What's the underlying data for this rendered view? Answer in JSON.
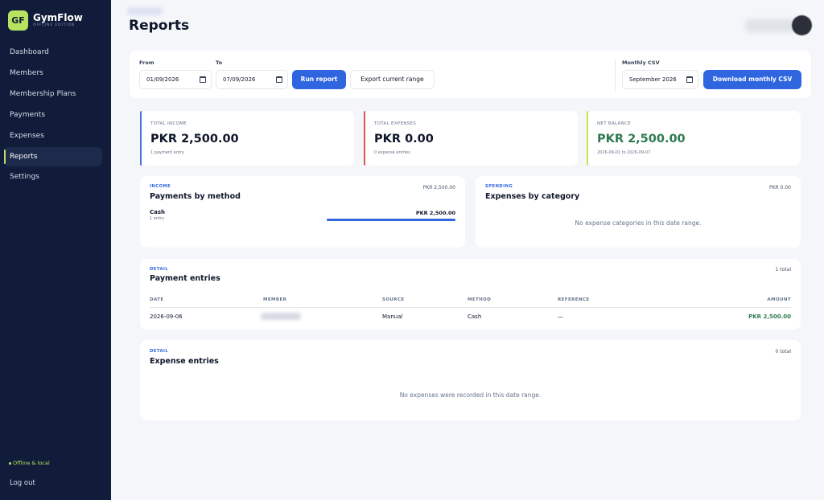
{
  "app": {
    "logo": "GF",
    "name": "GymFlow",
    "edition": "OFFLINE EDITION"
  },
  "sidebar": {
    "items": [
      {
        "label": "Dashboard"
      },
      {
        "label": "Members"
      },
      {
        "label": "Membership Plans"
      },
      {
        "label": "Payments"
      },
      {
        "label": "Expenses"
      },
      {
        "label": "Reports",
        "active": true
      },
      {
        "label": "Settings"
      }
    ],
    "status": "Offline & local",
    "logout": "Log out"
  },
  "header": {
    "title": "Reports"
  },
  "filters": {
    "from_label": "From",
    "from_value": "01/09/2026",
    "to_label": "To",
    "to_value": "07/09/2026",
    "run_label": "Run report",
    "export_label": "Export current range",
    "csv_label": "Monthly CSV",
    "csv_month": "September 2026",
    "download_label": "Download monthly CSV"
  },
  "stats": [
    {
      "label": "TOTAL INCOME",
      "value": "PKR 2,500.00",
      "sub": "1 payment entry",
      "color": "#4a73d9"
    },
    {
      "label": "TOTAL EXPENSES",
      "value": "PKR 0.00",
      "sub": "0 expense entries",
      "color": "#d65858"
    },
    {
      "label": "NET BALANCE",
      "value": "PKR 2,500.00",
      "sub": "2026-09-01 to 2026-09-07",
      "color": "#c7e34f",
      "value_color": "#2f7a4f"
    }
  ],
  "income": {
    "kicker": "INCOME",
    "title": "Payments by method",
    "total": "PKR 2,500.00",
    "methods": [
      {
        "name": "Cash",
        "count": "1 entry",
        "amount": "PKR 2,500.00",
        "share": 1.0
      }
    ]
  },
  "spending": {
    "kicker": "SPENDING",
    "title": "Expenses by category",
    "total": "PKR 0.00",
    "empty": "No expense categories in this date range."
  },
  "payments": {
    "kicker": "DETAIL",
    "title": "Payment entries",
    "count": "1 total",
    "columns": [
      "DATE",
      "MEMBER",
      "SOURCE",
      "METHOD",
      "REFERENCE",
      "AMOUNT"
    ],
    "rows": [
      {
        "date": "2026-09-06",
        "member": "",
        "source": "Manual",
        "method": "Cash",
        "reference": "—",
        "amount": "PKR 2,500.00"
      }
    ]
  },
  "expenses": {
    "kicker": "DETAIL",
    "title": "Expense entries",
    "count": "0 total",
    "empty": "No expenses were recorded in this date range."
  },
  "colors": {
    "sidebar": "#101c3a",
    "accent": "#2f66e0",
    "lime": "#b7e35f",
    "positive": "#2f7a4f"
  }
}
